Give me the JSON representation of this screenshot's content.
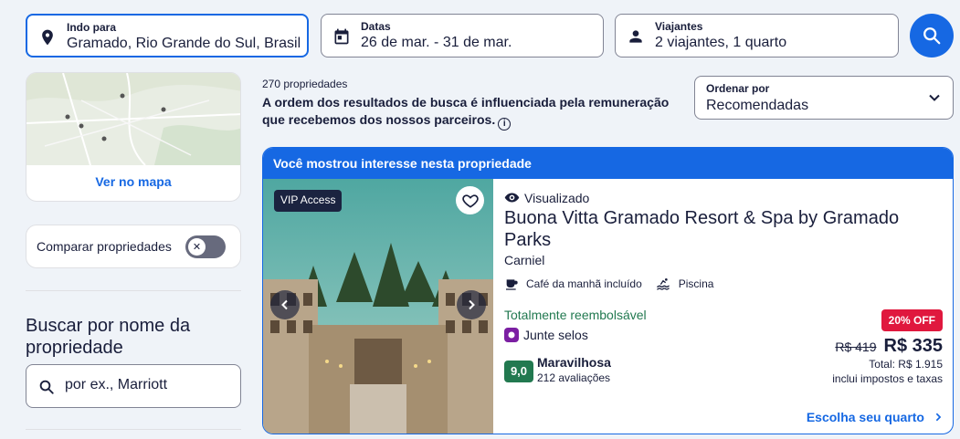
{
  "search": {
    "destination": {
      "label": "Indo para",
      "value": "Gramado, Rio Grande do Sul, Brasil",
      "icon": "location-pin-icon"
    },
    "dates": {
      "label": "Datas",
      "value": "26 de mar. - 31 de mar.",
      "icon": "calendar-icon"
    },
    "travelers": {
      "label": "Viajantes",
      "value": "2 viajantes, 1 quarto",
      "icon": "person-icon"
    },
    "submit_icon": "search-icon"
  },
  "sidebar": {
    "map_link": "Ver no mapa",
    "compare_label": "Comparar propriedades",
    "compare_enabled": false,
    "name_search_title": "Buscar por nome da propriedade",
    "name_search_placeholder": "por ex., Marriott"
  },
  "results": {
    "count": "270 propriedades",
    "disclaimer": "A ordem dos resultados de busca é influenciada pela remuneração que recebemos dos nossos parceiros.",
    "sort": {
      "label": "Ordenar por",
      "value": "Recomendadas"
    }
  },
  "listing": {
    "banner": "Você mostrou interesse nesta propriedade",
    "vip_badge": "VIP Access",
    "viewed": "Visualizado",
    "name": "Buona Vitta Gramado Resort & Spa by Gramado Parks",
    "location": "Carniel",
    "amenities": [
      "Café da manhã incluído",
      "Piscina"
    ],
    "refundable": "Totalmente reembolsável",
    "stamps": "Junte selos",
    "rating": {
      "score": "9,0",
      "word": "Maravilhosa",
      "reviews": "212 avaliações"
    },
    "discount_badge": "20% OFF",
    "old_price": "R$ 419",
    "price": "R$ 335",
    "total": "Total: R$ 1.915",
    "taxes": "inclui impostos e taxas",
    "cta": "Escolha seu quarto"
  },
  "colors": {
    "brand_blue": "#1668e3",
    "success_green": "#227950",
    "discount_red": "#e0183e",
    "dark_text": "#191e3b"
  }
}
